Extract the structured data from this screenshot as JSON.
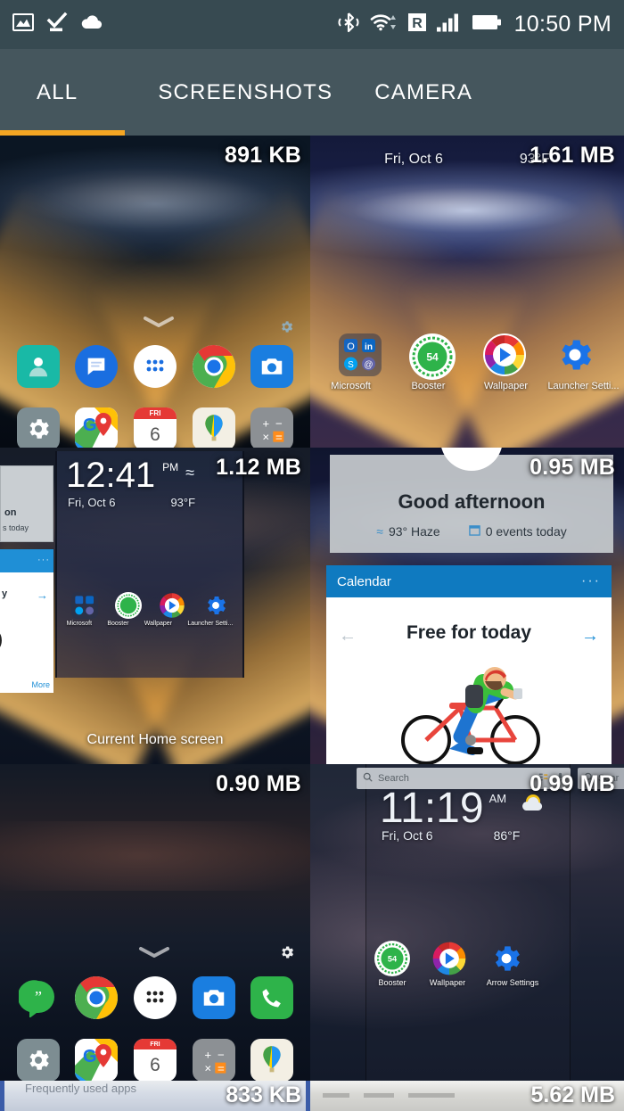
{
  "statusbar": {
    "icons": [
      "photo-icon",
      "download-complete-icon",
      "cloud-icon",
      "bluetooth-icon",
      "wifi-icon",
      "roaming-icon",
      "signal-bars-icon",
      "battery-icon"
    ],
    "roaming_letter": "R",
    "time": "10:50 PM"
  },
  "tabs": {
    "items": [
      {
        "label": "ALL",
        "active": true
      },
      {
        "label": "SCREENSHOTS",
        "active": false
      },
      {
        "label": "CAMERA",
        "active": false
      }
    ],
    "indicator_color": "#f5a623"
  },
  "colors": {
    "statusbar_bg": "#374a51",
    "tabbar_bg": "#45565d",
    "accent": "#f5a623",
    "calendar_blue": "#0f7ac0"
  },
  "gallery": {
    "items": [
      {
        "size": "891 KB",
        "kind": "home-screen-dark",
        "dock_icons": [
          "contacts-icon",
          "messages-icon",
          "app-drawer-icon",
          "chrome-icon",
          "camera-icon"
        ],
        "row2_icons": [
          "settings-icon",
          "maps-icon",
          "calendar-icon",
          "photos-icon",
          "calculator-icon"
        ],
        "calendar_day": "6",
        "calendar_dow": "FRI"
      },
      {
        "size": "1.61 MB",
        "kind": "home-screen-milkyway",
        "date": "Fri, Oct 6",
        "temp": "93°F",
        "app_labels": [
          "Microsoft",
          "Booster",
          "Wallpaper",
          "Launcher Setti..."
        ],
        "booster_percent": "54"
      },
      {
        "size": "1.12 MB",
        "kind": "home-screen-preview",
        "clock": "12:41",
        "clock_meridiem": "PM",
        "date": "Fri, Oct 6",
        "temp": "93°F",
        "caption": "Current Home screen",
        "app_labels": [
          "Microsoft",
          "Booster",
          "Wallpaper",
          "Launcher Setti..."
        ],
        "side_card_fragments": [
          "on",
          "s today",
          "y",
          "More"
        ]
      },
      {
        "size": "0.95 MB",
        "kind": "google-now-cards",
        "greeting": "Good afternoon",
        "weather": "93° Haze",
        "events": "0 events today",
        "card_title": "Calendar",
        "card_body": "Free for today",
        "card_menu": "···",
        "illustration": "cyclist-illustration"
      },
      {
        "size": "0.90 MB",
        "kind": "home-screen-dark2",
        "dock_icons": [
          "hangouts-icon",
          "chrome-icon",
          "app-drawer-icon",
          "camera-icon",
          "phone-icon"
        ],
        "row2_icons": [
          "settings-icon",
          "maps-icon",
          "calendar-icon",
          "calculator-icon",
          "photos-icon"
        ],
        "calendar_day": "6",
        "calendar_dow": "FRI"
      },
      {
        "size": "0.99 MB",
        "kind": "home-screen-dusk",
        "search_placeholder": "Search",
        "search_placeholder_2": "Sear",
        "clock": "11:19",
        "clock_meridiem": "AM",
        "date": "Fri, Oct 6",
        "temp": "86°F",
        "app_labels": [
          "Booster",
          "Wallpaper",
          "Arrow Settings"
        ],
        "booster_percent": "54"
      },
      {
        "size": "833 KB",
        "kind": "cut-off-light",
        "header_text": "Frequently used apps"
      },
      {
        "size": "5.62 MB",
        "kind": "cut-off-document",
        "header_text": ""
      }
    ]
  }
}
